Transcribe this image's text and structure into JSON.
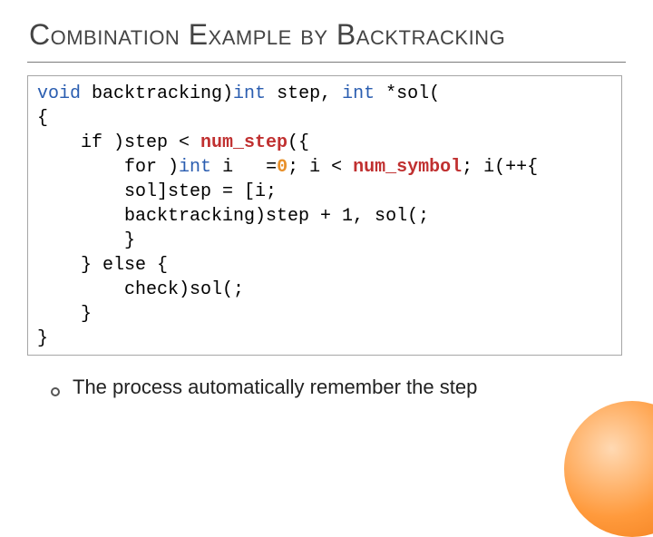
{
  "title": "Combination Example by Backtracking",
  "code": {
    "l1_a": "void",
    "l1_b": " backtracking)",
    "l1_c": "int",
    "l1_d": " step, ",
    "l1_e": "int",
    "l1_f": " *sol(",
    "l2": "{",
    "l3_a": "    if ",
    "l3_b": ")step < ",
    "l3_c": "num_step",
    "l3_d": "({",
    "l4_a": "        for ",
    "l4_b": ")",
    "l4_c": "int",
    "l4_d": " i   =",
    "l4_e": "0",
    "l4_f": "; i < ",
    "l4_g": "num_symbol",
    "l4_h": "; i(++{",
    "l5": "        sol]step = [i;",
    "l6": "        backtracking)step + 1, sol(;",
    "l7": "        }",
    "l8": "    } else {",
    "l9": "        check)sol(;",
    "l10": "    }",
    "l11": "}"
  },
  "bullet_text": "The process automatically remember the step"
}
